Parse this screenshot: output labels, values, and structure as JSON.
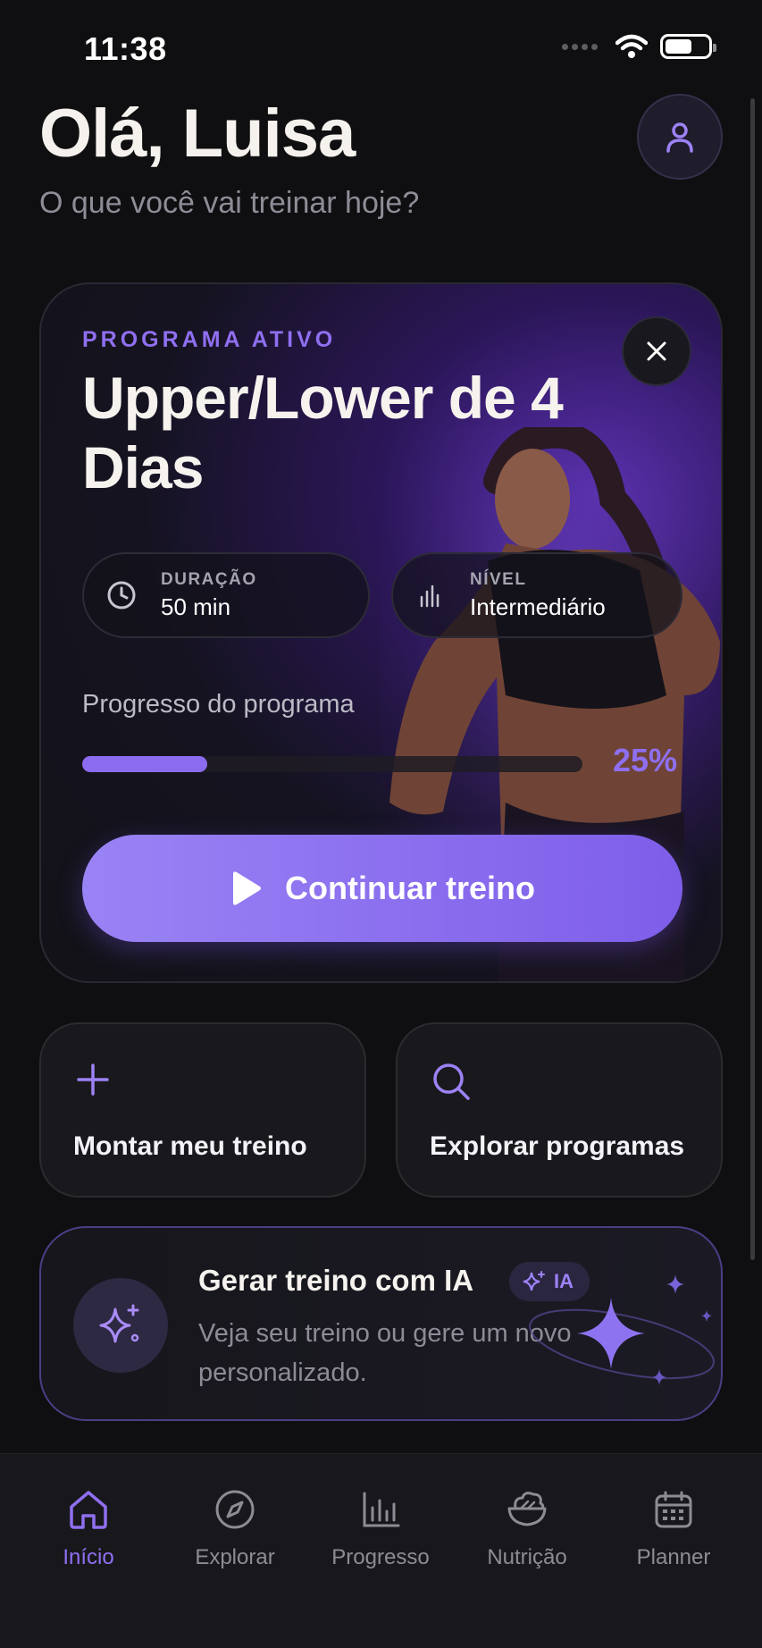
{
  "status_bar": {
    "time": "11:38"
  },
  "header": {
    "greeting": "Olá, Luisa",
    "subtitle": "O que você vai treinar hoje?"
  },
  "program_card": {
    "label": "PROGRAMA ATIVO",
    "title": "Upper/Lower de 4 Dias",
    "duration": {
      "label": "DURAÇÃO",
      "value": "50 min",
      "icon": "clock-icon"
    },
    "level": {
      "label": "NÍVEL",
      "value": "Intermediário",
      "icon": "bar-chart-icon"
    },
    "progress_label": "Progresso do programa",
    "progress_value": 0.25,
    "progress_text": "25%",
    "continue_label": "Continuar treino"
  },
  "quick_actions": [
    {
      "label": "Montar meu treino",
      "icon": "plus-icon"
    },
    {
      "label": "Explorar programas",
      "icon": "search-icon"
    }
  ],
  "ai_card": {
    "title": "Gerar treino com IA",
    "badge": "IA",
    "description": "Veja seu treino ou gere um novo personalizado."
  },
  "tab_bar": {
    "tabs": [
      {
        "label": "Início",
        "icon": "home-icon",
        "active": true
      },
      {
        "label": "Explorar",
        "icon": "compass-icon",
        "active": false
      },
      {
        "label": "Progresso",
        "icon": "bar-chart-icon",
        "active": false
      },
      {
        "label": "Nutrição",
        "icon": "salad-bowl-icon",
        "active": false
      },
      {
        "label": "Planner",
        "icon": "calendar-icon",
        "active": false
      }
    ]
  },
  "colors": {
    "accent": "#8f6ff0",
    "background": "#0f0f11",
    "card": "#19191d",
    "text_primary": "#f5f1ec",
    "text_muted": "#8e8c96"
  }
}
